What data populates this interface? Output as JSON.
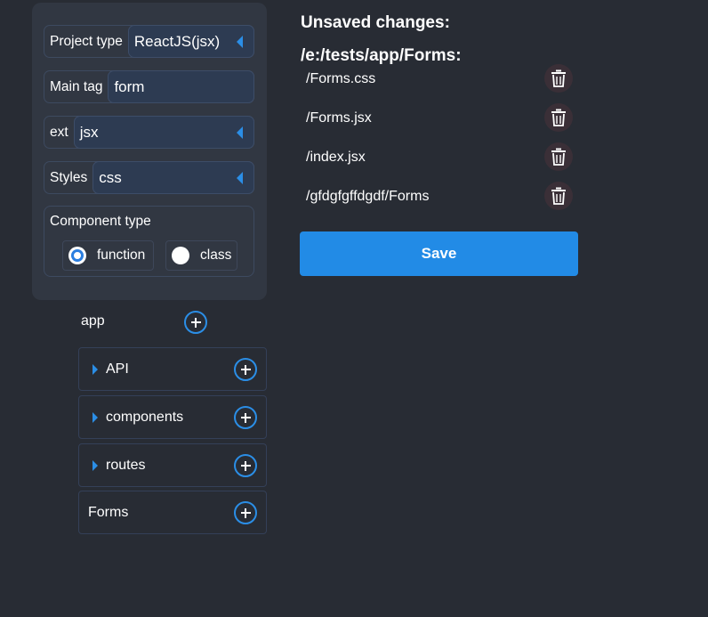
{
  "settings": {
    "project_type": {
      "label": "Project type",
      "value": "ReactJS(jsx)"
    },
    "main_tag": {
      "label": "Main tag",
      "value": "form"
    },
    "ext": {
      "label": "ext",
      "value": "jsx"
    },
    "styles": {
      "label": "Styles",
      "value": "css"
    },
    "component_type": {
      "title": "Component type",
      "options": [
        "function",
        "class"
      ],
      "selected": "function"
    }
  },
  "tree": {
    "root": "app",
    "items": [
      {
        "label": "API",
        "expandable": true
      },
      {
        "label": "components",
        "expandable": true
      },
      {
        "label": "routes",
        "expandable": true
      },
      {
        "label": "Forms",
        "expandable": false
      }
    ]
  },
  "changes": {
    "title": "Unsaved changes:",
    "path": "/e:/tests/app/Forms:",
    "files": [
      "/Forms.css",
      "/Forms.jsx",
      "/index.jsx",
      "/gfdgfgffdgdf/Forms"
    ],
    "save_label": "Save"
  },
  "colors": {
    "background": "#282c34",
    "panel": "#313742",
    "accent": "#228be6"
  }
}
